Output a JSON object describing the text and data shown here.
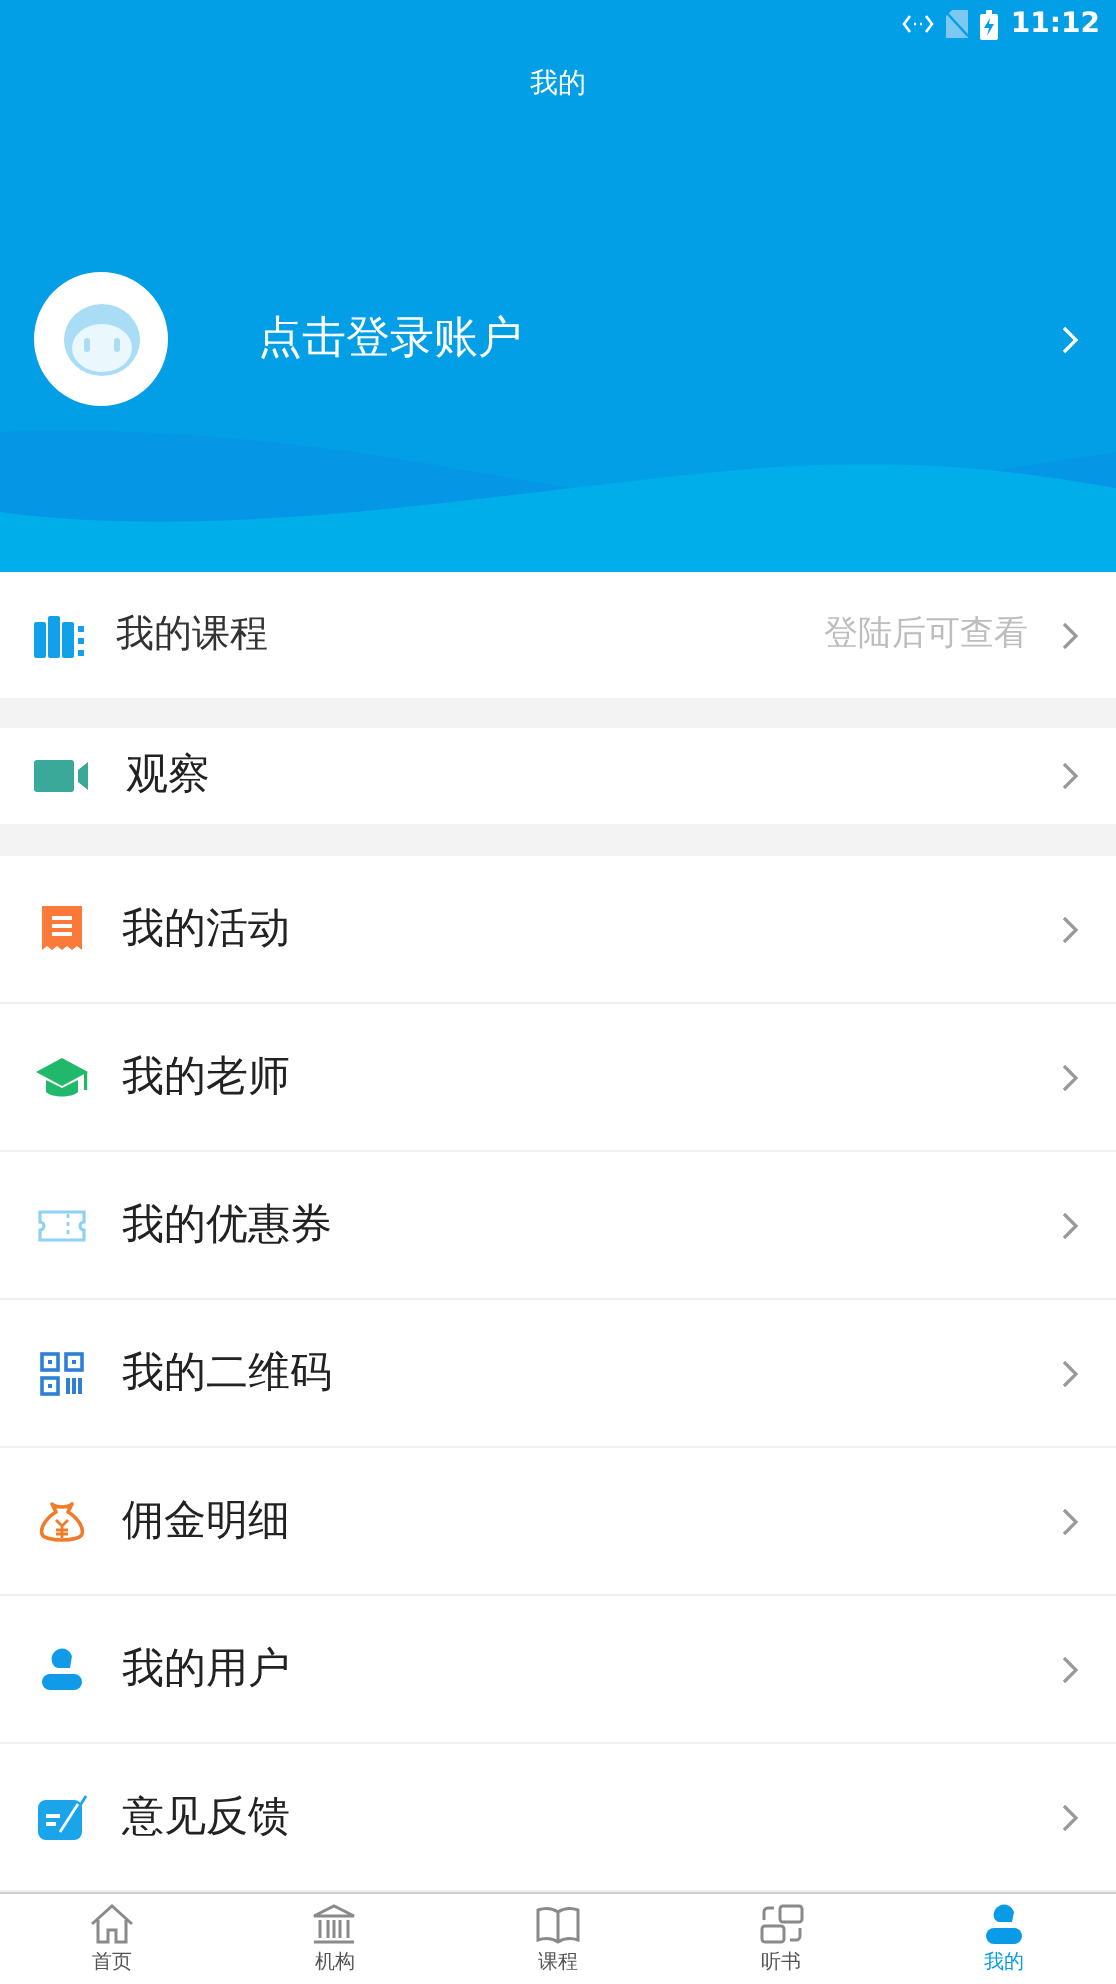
{
  "status_bar": {
    "time": "11:12"
  },
  "header": {
    "title": "我的",
    "login_text": "点击登录账户"
  },
  "courses": {
    "label": "我的课程",
    "hint": "登陆后可查看"
  },
  "observe": {
    "label": "观察"
  },
  "menu": [
    {
      "kind": "activity",
      "label": "我的活动"
    },
    {
      "kind": "teacher",
      "label": "我的老师"
    },
    {
      "kind": "coupon",
      "label": "我的优惠券"
    },
    {
      "kind": "qrcode",
      "label": "我的二维码"
    },
    {
      "kind": "commission",
      "label": "佣金明细"
    },
    {
      "kind": "users",
      "label": "我的用户"
    },
    {
      "kind": "feedback",
      "label": "意见反馈"
    }
  ],
  "tab_bar": [
    {
      "kind": "home",
      "label": "首页",
      "selected": false
    },
    {
      "kind": "institution",
      "label": "机构",
      "selected": false
    },
    {
      "kind": "course",
      "label": "课程",
      "selected": false
    },
    {
      "kind": "listen",
      "label": "听书",
      "selected": false
    },
    {
      "kind": "mine",
      "label": "我的",
      "selected": true
    }
  ]
}
